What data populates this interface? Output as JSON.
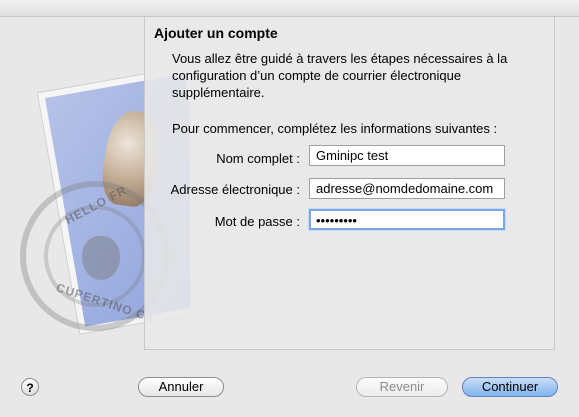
{
  "assistant": {
    "title": "Ajouter un compte",
    "intro": "Vous allez être guidé à travers les étapes nécessaires à la configuration d’un compte de courrier électronique supplémentaire.",
    "prompt": "Pour commencer, complétez les informations suivantes :",
    "fields": {
      "name": {
        "label": "Nom complet :",
        "value": "Gminipc test"
      },
      "email": {
        "label": "Adresse électronique :",
        "value": "adresse@nomdedomaine.com"
      },
      "password": {
        "label": "Mot de passe :",
        "value": "•••••••••"
      }
    }
  },
  "decor": {
    "postmark_top": "HELLO FR",
    "postmark_bottom": "CUPERTINO CA"
  },
  "buttons": {
    "help": "?",
    "cancel": "Annuler",
    "back": "Revenir",
    "continue": "Continuer"
  }
}
